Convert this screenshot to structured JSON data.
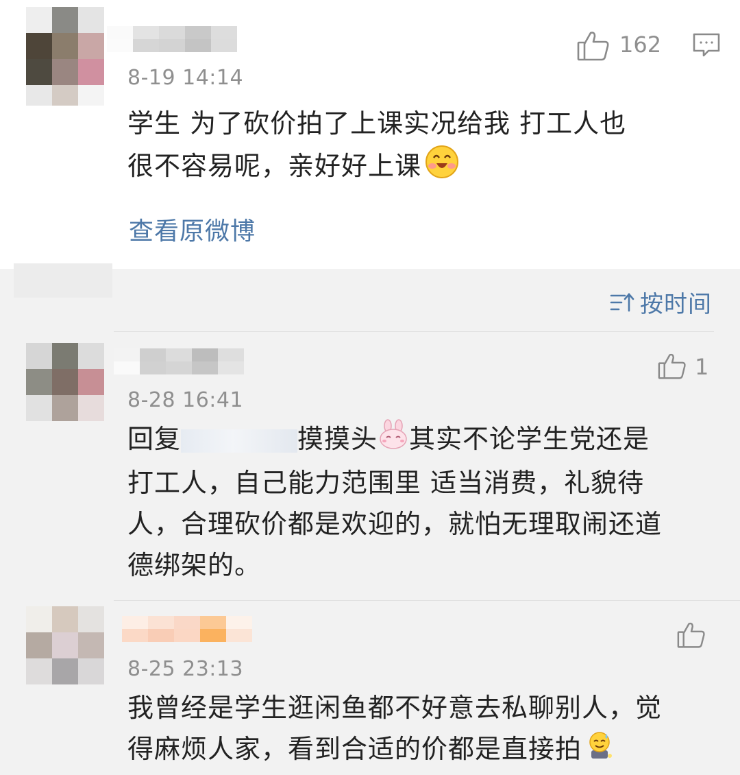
{
  "top_comment": {
    "likes": "162",
    "time": "8-19 14:14",
    "text_line1": "学生 为了砍价拍了上课实况给我 打工人也",
    "text_line2": "很不容易呢，亲好好上课",
    "emoji": "grinning-blush-emoji",
    "view_original": "查看原微博"
  },
  "sort": {
    "label": "按时间",
    "icon": "sort-icon"
  },
  "replies": [
    {
      "likes": "1",
      "time": "8-28 16:41",
      "prefix": "回复",
      "lead": "摸摸头",
      "emoji": "bunny-emoji",
      "line1_rest": "其实不论学生党还是",
      "line2": "打工人，自己能力范围里 适当消费，礼貌待",
      "line3": "人，合理砍价都是欢迎的，就怕无理取闹还道",
      "line4": "德绑架的。"
    },
    {
      "likes": "",
      "time": "8-25 23:13",
      "line1": "我曾经是学生逛闲鱼都不好意去私聊别人，觉",
      "line2": "得麻烦人家，看到合适的价都是直接拍",
      "emoji": "sweat-smile-emoji"
    }
  ],
  "colors": {
    "link": "#4d78a8",
    "muted": "#8f8f8f",
    "text": "#222222",
    "card": "#ffffff",
    "page": "#f2f2f2"
  }
}
